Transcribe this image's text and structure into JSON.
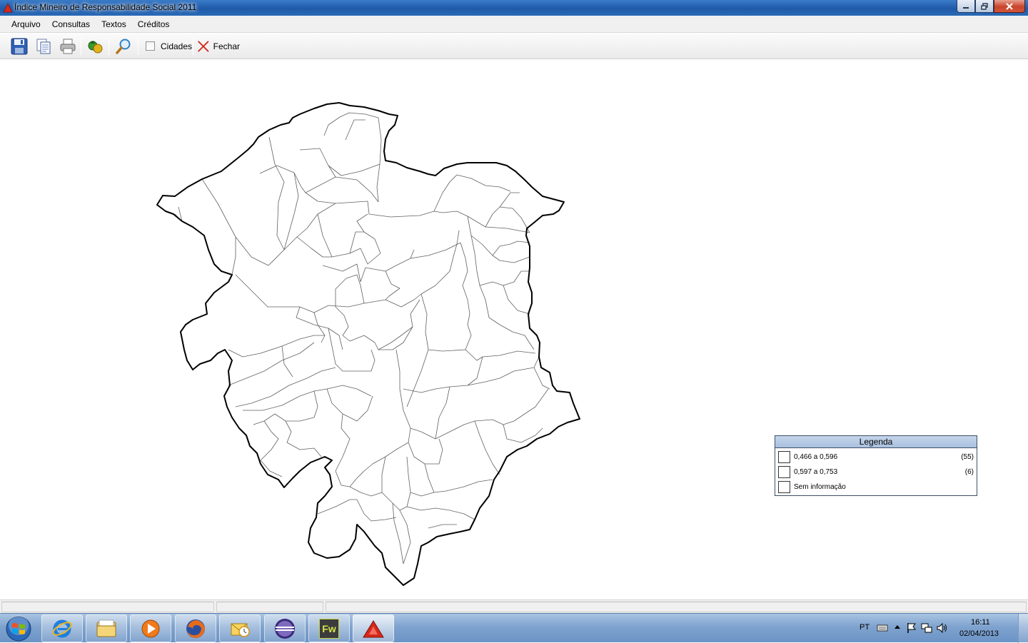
{
  "window": {
    "title": "Índice Mineiro de Responsabilidade Social 2011",
    "controls": [
      "minimize",
      "maximize",
      "close"
    ]
  },
  "menu": {
    "items": [
      "Arquivo",
      "Consultas",
      "Textos",
      "Créditos"
    ]
  },
  "toolbar": {
    "buttons": [
      "save-icon",
      "copy-icon",
      "print-icon",
      "refresh-icon",
      "zoom-icon"
    ],
    "cidades_label": "Cidades",
    "cidades_checked": false,
    "fechar_label": "Fechar"
  },
  "legend": {
    "title": "Legenda",
    "rows": [
      {
        "label": "0,466 a 0,596",
        "count": "(55)",
        "color": "#ffffff"
      },
      {
        "label": "0,597 a 0,753",
        "count": "(6)",
        "color": "#ffffff"
      },
      {
        "label": "Sem informação",
        "count": "",
        "color": "#ffffff"
      }
    ]
  },
  "taskbar": {
    "apps": [
      "internet-explorer-icon",
      "windows-explorer-icon",
      "media-player-icon",
      "firefox-icon",
      "outlook-icon",
      "eclipse-icon",
      "fireworks-icon",
      "imrs-app-icon"
    ],
    "fireworks_label": "Fw",
    "language": "PT",
    "time": "16:11",
    "date": "02/04/2013"
  }
}
